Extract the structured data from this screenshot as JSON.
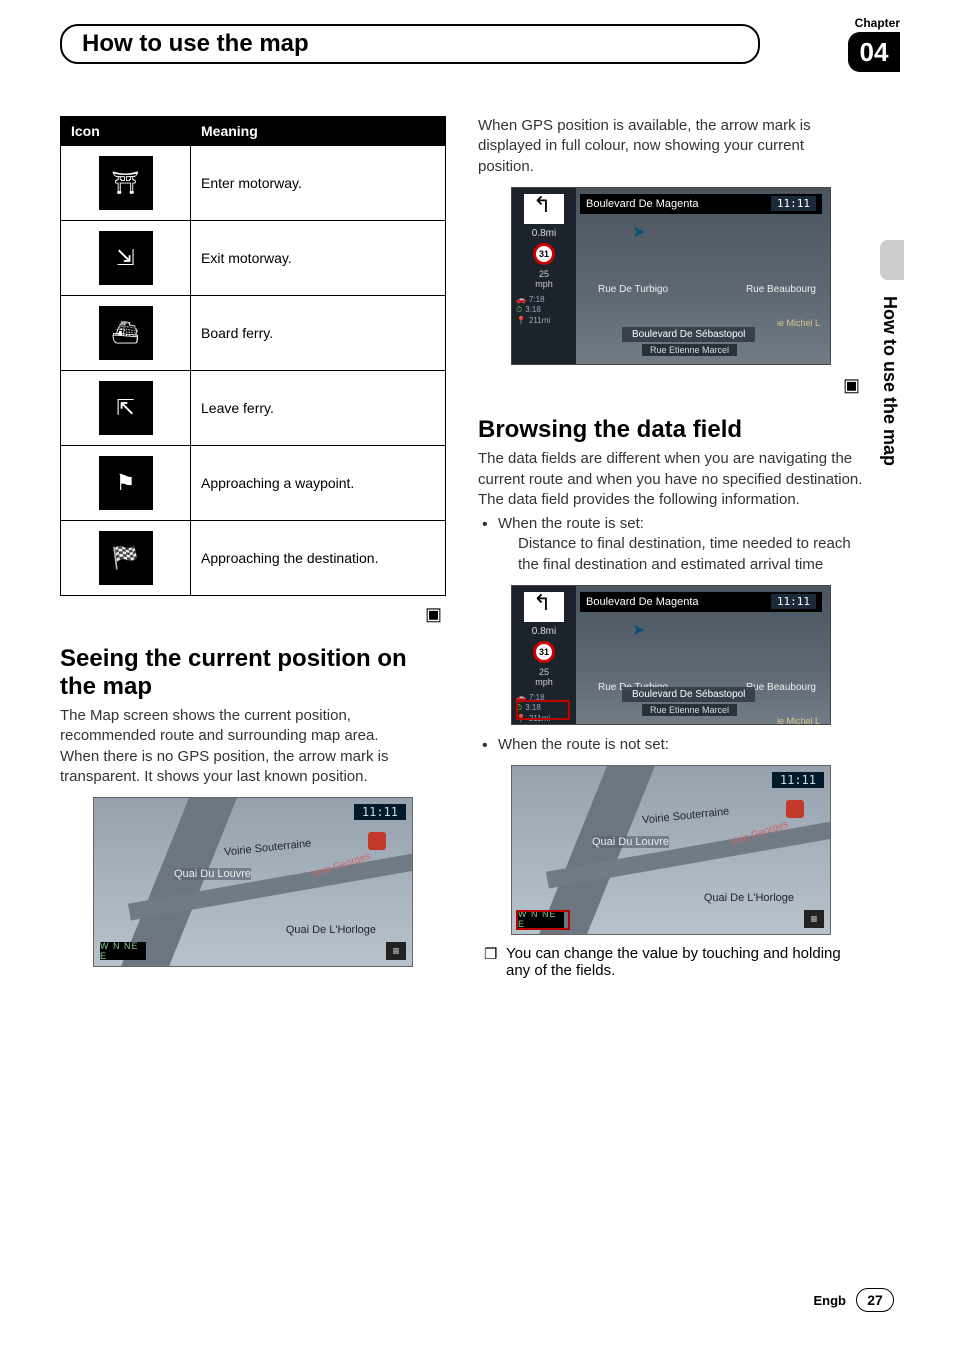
{
  "chapter": {
    "label": "Chapter",
    "number": "04"
  },
  "page_title": "How to use the map",
  "side_label": "How to use the map",
  "table": {
    "head_icon": "Icon",
    "head_meaning": "Meaning",
    "rows": [
      {
        "icon_name": "enter-motorway-icon",
        "glyph": "⛩",
        "meaning": "Enter motorway."
      },
      {
        "icon_name": "exit-motorway-icon",
        "glyph": "⇲",
        "meaning": "Exit motorway."
      },
      {
        "icon_name": "board-ferry-icon",
        "glyph": "⛴",
        "meaning": "Board ferry."
      },
      {
        "icon_name": "leave-ferry-icon",
        "glyph": "⇱",
        "meaning": "Leave ferry."
      },
      {
        "icon_name": "waypoint-flag-icon",
        "glyph": "⚑",
        "meaning": "Approaching a waypoint."
      },
      {
        "icon_name": "destination-flag-icon",
        "glyph": "🏁",
        "meaning": "Approaching the destination."
      }
    ]
  },
  "section_end_glyph": "▣",
  "left": {
    "h2": "Seeing the current position on the map",
    "p1": "The Map screen shows the current position, recommended route and surrounding map area.",
    "p2": "When there is no GPS position, the arrow mark is transparent. It shows your last known position."
  },
  "right": {
    "intro": "When GPS position is available, the arrow mark is displayed in full colour, now showing your current position.",
    "h2": "Browsing the data field",
    "p1": "The data fields are different when you are navigating the current route and when you have no specified destination. The data field provides the following information.",
    "bullet1": "When the route is set:",
    "bullet1_sub": "Distance to final destination, time needed to reach the final destination and estimated arrival time",
    "bullet2": "When the route is not set:",
    "note": "You can change the value by touching and holding any of the fields."
  },
  "map2d": {
    "top_street": "Boulevard De Magenta",
    "time": "11:11",
    "dist": "0.8mi",
    "speed_sign": "31",
    "speed": "25",
    "speed_unit": "mph",
    "info1_icon": "🚗",
    "info1": "7:18",
    "info2_icon": "⏱",
    "info2": "3:18",
    "info3_icon": "📍",
    "info3": "211mi",
    "street_left": "Rue De Turbigo",
    "street_right": "Rue Beaubourg",
    "street_right2": "ie Michel L",
    "bottom1": "Boulevard De Sébastopol",
    "bottom2": "Rue Etienne Marcel"
  },
  "map3d": {
    "time": "11:11",
    "street1": "Voirie Souterraine",
    "street2": "Quai Du Louvre",
    "street3": "Voie Georges",
    "street4": "Quai De L'Horloge",
    "compass": "W N NE E",
    "menu": "≡"
  },
  "footer": {
    "lang": "Engb",
    "page": "27"
  }
}
